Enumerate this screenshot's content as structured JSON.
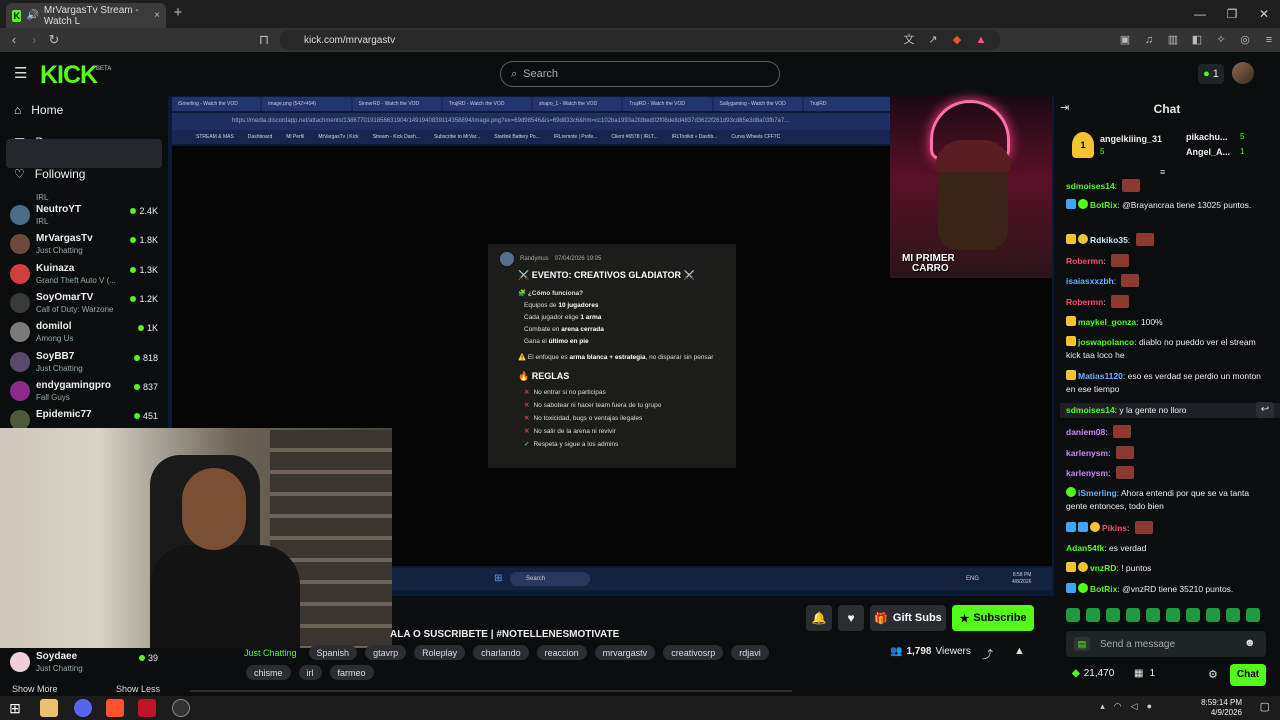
{
  "browser": {
    "tab_title": "MrVargasTv Stream - Watch L",
    "url": "kick.com/mrvargastv",
    "new_tab": "+",
    "back": "‹",
    "forward": "›",
    "reload": "↻"
  },
  "header": {
    "brand": "KICK",
    "beta": "BETA",
    "search_placeholder": "Search",
    "notifications_count": "1"
  },
  "sidebar": {
    "home": "Home",
    "browse": "Browse",
    "following": "Following",
    "top_partial_category": "IRL",
    "channels": [
      {
        "name": "NeutroYT",
        "category": "IRL",
        "viewers": "2.4K",
        "color": "#4a6a8a"
      },
      {
        "name": "MrVargasTv",
        "category": "Just Chatting",
        "viewers": "1.8K",
        "color": "#6b4a3a"
      },
      {
        "name": "Kuinaza",
        "category": "Grand Theft Auto V (...",
        "viewers": "1.3K",
        "color": "#d04040"
      },
      {
        "name": "SoyOmarTV",
        "category": "Call of Duty: Warzone",
        "viewers": "1.2K",
        "color": "#3a3a3a"
      },
      {
        "name": "domilol",
        "category": "Among Us",
        "viewers": "1K",
        "color": "#7a7a7a"
      },
      {
        "name": "SoyBB7",
        "category": "Just Chatting",
        "viewers": "818",
        "color": "#5a4a6a"
      },
      {
        "name": "endygamingpro",
        "category": "Fall Guys",
        "viewers": "837",
        "color": "#8a2a8a"
      },
      {
        "name": "Epidemic77",
        "category": "",
        "viewers": "451",
        "color": "#4a5a3a"
      }
    ],
    "bottom_channel": {
      "name": "Soydaee",
      "category": "Just Chatting",
      "viewers": "39"
    },
    "show_more": "Show More",
    "show_less": "Show Less"
  },
  "inner_browser": {
    "tabs": [
      "iSmerling - Watch the VOD",
      "image.png (542×494)",
      "SinnerRD - Watch the VOD",
      "TrujiRD - Watch the VOD",
      "shapo_1 - Watch the VOD",
      "TrujiRD - Watch the VOD",
      "Sallygaming - Watch the VOD",
      "TrujiRD"
    ],
    "url": "https://media.discordapp.net/attachments/1386770191856631904/1491940839114358894/image.png?ex=69d98546&is=69d833c6&hm=cc102ba1993a2fdbed02f08de8d4837d3622f261d93cd85e3d8a03fb7a7...",
    "bookmarks": [
      "STREAM & MAS",
      "Dashboard",
      "Mi Perfil",
      "MrVargasTv | Kick",
      "Stream - Kick Dash...",
      "Subscribe to MrVar...",
      "Starlink Battery Po...",
      "IRLremote | Profe...",
      "Client #6578 | IRLT...",
      "IRLToolkit » Dashb...",
      "Curva Wheels CFF7C"
    ],
    "taskbar_search": "Search",
    "taskbar_time": "8:58 PM",
    "taskbar_date": "4/8/2026",
    "lang": "ENG"
  },
  "event_card": {
    "author": "Randymus",
    "date": "07/04/2026 19:05",
    "title": "⚔️ EVENTO: CREATIVOS GLADIATOR ⚔️",
    "how_heading": "🧩 ¿Cómo funciona?",
    "how_items": [
      {
        "pre": "Equipos de ",
        "bold": "10 jugadores",
        "post": ""
      },
      {
        "pre": "Cada jugador elige ",
        "bold": "1 arma",
        "post": ""
      },
      {
        "pre": "Combate en ",
        "bold": "arena cerrada",
        "post": ""
      },
      {
        "pre": "Gana el ",
        "bold": "último en pie",
        "post": ""
      }
    ],
    "focus_pre": "⚠️ El enfoque es ",
    "focus_bold": "arma blanca + estrategia",
    "focus_post": ", no disparar sin pensar",
    "rules_heading": "🔥 REGLAS",
    "rules": [
      "No entrar si no participas",
      "No sabotear ni hacer team fuera de tu grupo",
      "No toxicidad, bugs o ventajas ilegales",
      "No salir de la arena ni revivir"
    ],
    "last_rule": "Respeta y sigue a los admins"
  },
  "overlay": {
    "webcam_text_1": "MI PRIMER",
    "webcam_text_2": "CARRO"
  },
  "stream": {
    "title_partial": "ALA O SUSCRIBETE | #NOTELLENESMOTIVATE",
    "category": "Just Chatting",
    "tags_row1": [
      "Spanish",
      "gtavrp",
      "Roleplay",
      "charlando",
      "reaccion",
      "mrvargastv",
      "creativosrp",
      "rdjavi"
    ],
    "tags_row2": [
      "chisme",
      "irl",
      "farmeo"
    ],
    "viewers": "1,798",
    "viewers_label": "Viewers",
    "gift_label": "Gift Subs",
    "subscribe_label": "Subscribe"
  },
  "chat": {
    "title": "Chat",
    "pinned": {
      "gift_count": "1",
      "top_user": "angelkiiing_31",
      "top_count": "5",
      "second_user": "pikachu...",
      "second_count": "5",
      "third_user": "Angel_A...",
      "third_count": "1"
    },
    "messages": [
      {
        "user": "sdmoises14",
        "text": "",
        "emote": true,
        "cls": "u-green",
        "badges": []
      },
      {
        "user": "BotRix",
        "text": "@Brayancraa tiene 13025 puntos.",
        "emote": false,
        "cls": "u-green",
        "badges": [
          "b-shield",
          "b-verify"
        ]
      },
      {
        "user": "Rdkiko35",
        "text": "",
        "emote": true,
        "cls": "u-white",
        "badges": [
          "b-crown",
          "b-moon"
        ]
      },
      {
        "user": "Robermn",
        "text": "",
        "emote": true,
        "cls": "u-red",
        "badges": []
      },
      {
        "user": "isaiasxxzbh",
        "text": "",
        "emote": true,
        "cls": "u-blue",
        "badges": []
      },
      {
        "user": "Robermn",
        "text": "",
        "emote": true,
        "cls": "u-red",
        "badges": []
      },
      {
        "user": "maykel_gonza",
        "text": "100%",
        "emote": false,
        "cls": "u-green",
        "badges": [
          "b-crown"
        ]
      },
      {
        "user": "joswapolanco",
        "text": "diablo no pueddo ver el stream kick taa loco he",
        "emote": false,
        "cls": "u-green",
        "badges": [
          "b-crown"
        ]
      },
      {
        "user": "Matias1120",
        "text": "eso es verdad se perdio un monton en ese tiempo",
        "emote": false,
        "cls": "u-blue",
        "badges": [
          "b-crown"
        ]
      },
      {
        "user": "sdmoises14",
        "text": "y la gente no lloro",
        "emote": false,
        "cls": "u-green",
        "badges": []
      },
      {
        "user": "daniem08",
        "text": "",
        "emote": true,
        "cls": "u-purple",
        "badges": []
      },
      {
        "user": "karlenysm",
        "text": "",
        "emote": true,
        "cls": "u-purple",
        "badges": []
      },
      {
        "user": "karlenysm",
        "text": "",
        "emote": true,
        "cls": "u-purple",
        "badges": []
      },
      {
        "user": "iSmerling",
        "text": "Ahora entendi por que se va tanta gente entonces, todo bien",
        "emote": false,
        "cls": "u-blue",
        "badges": [
          "b-verify"
        ]
      },
      {
        "user": "Pikins",
        "text": "",
        "emote": true,
        "cls": "u-red",
        "badges": [
          "b-shield",
          "b-shield",
          "b-moon"
        ]
      },
      {
        "user": "Adan54fk",
        "text": "es verdad",
        "emote": false,
        "cls": "u-green",
        "badges": []
      },
      {
        "user": "vnzRD",
        "text": "! puntos",
        "emote": false,
        "cls": "u-green",
        "badges": [
          "b-crown",
          "b-moon"
        ]
      },
      {
        "user": "BotRix",
        "text": "@vnzRD tiene 35210 puntos.",
        "emote": false,
        "cls": "u-green",
        "badges": [
          "b-shield",
          "b-verify"
        ]
      }
    ],
    "send_placeholder": "Send a message",
    "points": "21,470",
    "bottom_count": "1",
    "chat_button": "Chat"
  },
  "taskbar": {
    "time": "8:59:14 PM",
    "date": "4/9/2026"
  },
  "colors": {
    "accent": "#53fc18",
    "bg": "#0b0e0f"
  }
}
